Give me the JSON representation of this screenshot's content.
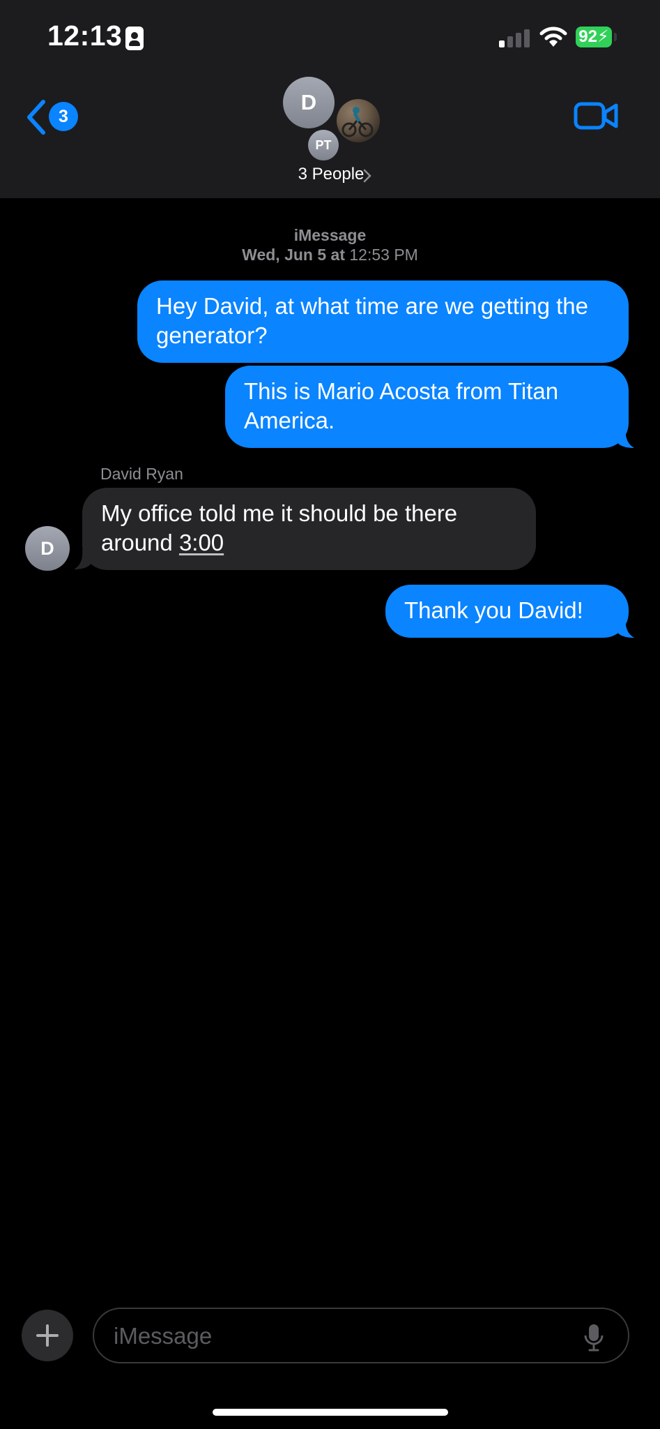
{
  "status_bar": {
    "time": "12:13",
    "battery": "92",
    "battery_color": "#30d158"
  },
  "header": {
    "back_count": "3",
    "avatar_initial": "D",
    "avatar2_initials": "PT",
    "group_label": "3 People",
    "accent_color": "#0a84ff"
  },
  "conversation": {
    "service": "iMessage",
    "date": "Wed, Jun 5 at",
    "time": "12:53 PM",
    "sender_name": "David Ryan",
    "sender_initial": "D",
    "messages": [
      {
        "from": "me",
        "text": "Hey David, at what time are we getting the generator?"
      },
      {
        "from": "me",
        "text": "This is Mario Acosta from Titan America."
      },
      {
        "from": "David Ryan",
        "text_prefix": "My office told me it should be there around ",
        "text_link": "3:00"
      },
      {
        "from": "me",
        "text": "Thank you David!"
      }
    ]
  },
  "composer": {
    "placeholder": "iMessage"
  }
}
